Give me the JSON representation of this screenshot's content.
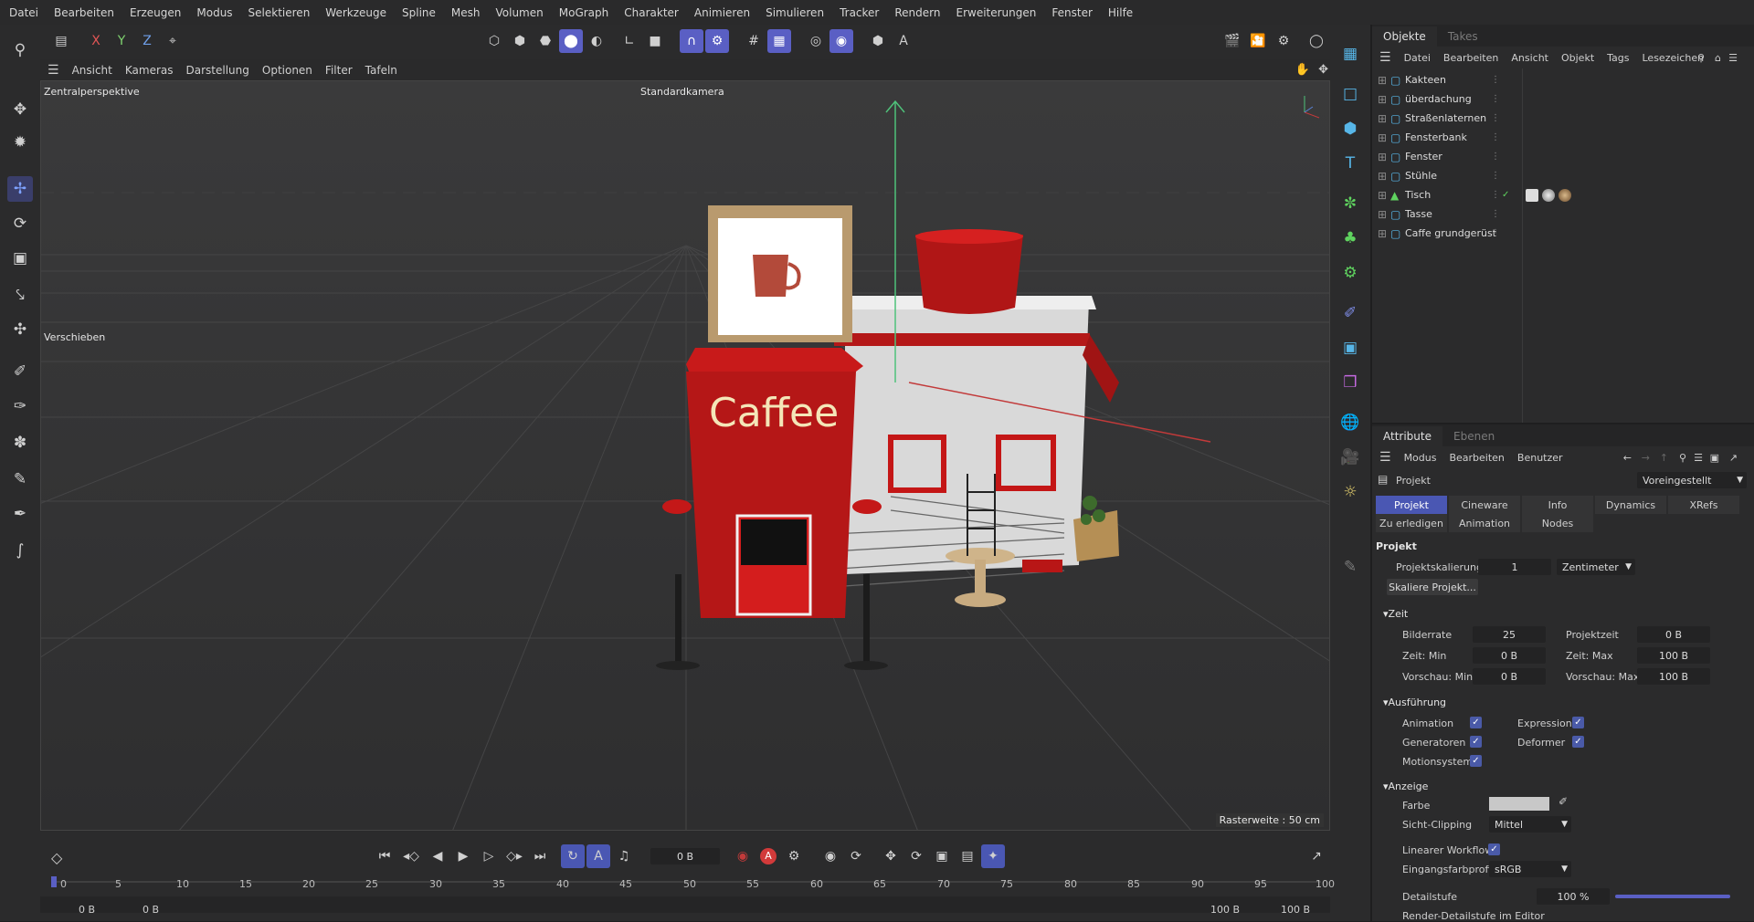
{
  "menubar": {
    "items": [
      "Datei",
      "Bearbeiten",
      "Erzeugen",
      "Modus",
      "Selektieren",
      "Werkzeuge",
      "Spline",
      "Mesh",
      "Volumen",
      "MoGraph",
      "Charakter",
      "Animieren",
      "Simulieren",
      "Tracker",
      "Rendern",
      "Erweiterungen",
      "Fenster",
      "Hilfe"
    ]
  },
  "toolbar": {
    "axis_x": "X",
    "axis_y": "Y",
    "axis_z": "Z"
  },
  "viewmenu": {
    "items": [
      "Ansicht",
      "Kameras",
      "Darstellung",
      "Optionen",
      "Filter",
      "Tafeln"
    ]
  },
  "viewport": {
    "perspective_label": "Zentralperspektive",
    "camera_label": "Standardkamera",
    "tool_label": "Verschieben",
    "grid_label": "Rasterweite : 50 cm",
    "sign_text": "Caffee"
  },
  "objects": {
    "tabs": [
      "Objekte",
      "Takes"
    ],
    "menu": [
      "Datei",
      "Bearbeiten",
      "Ansicht",
      "Objekt",
      "Tags",
      "Lesezeichen"
    ],
    "items": [
      {
        "name": "Kakteen"
      },
      {
        "name": "überdachung"
      },
      {
        "name": "Straßenlaternen"
      },
      {
        "name": "Fensterbank"
      },
      {
        "name": "Fenster"
      },
      {
        "name": "Stühle"
      },
      {
        "name": "Tisch"
      },
      {
        "name": "Tasse"
      },
      {
        "name": "Caffe grundgerüst"
      }
    ]
  },
  "attributes": {
    "tabs": [
      "Attribute",
      "Ebenen"
    ],
    "menu": [
      "Modus",
      "Bearbeiten",
      "Benutzer"
    ],
    "object_label": "Projekt",
    "preset": "Voreingestellt",
    "ptabs_row1": [
      "Projekt",
      "Cineware",
      "Info",
      "Dynamics",
      "XRefs"
    ],
    "ptabs_row2": [
      "Zu erledigen",
      "Animation",
      "Nodes"
    ],
    "section_projekt": "Projekt",
    "projektskalierung_label": "Projektskalierung",
    "projektskalierung_value": "1",
    "unit": "Zentimeter",
    "skalieren_button": "Skaliere Projekt...",
    "section_zeit": "Zeit",
    "bilderrate_label": "Bilderrate",
    "bilderrate": "25",
    "projektzeit_label": "Projektzeit",
    "projektzeit": "0 B",
    "zeitmin_label": "Zeit: Min",
    "zeitmin": "0 B",
    "zeitmax_label": "Zeit: Max",
    "zeitmax": "100 B",
    "vormin_label": "Vorschau: Min",
    "vormin": "0 B",
    "vormax_label": "Vorschau: Max",
    "vormax": "100 B",
    "section_ausfuehrung": "Ausführung",
    "animation_label": "Animation",
    "expressions_label": "Expressions",
    "generatoren_label": "Generatoren",
    "deformer_label": "Deformer",
    "motionsystem_label": "Motionsystem",
    "section_anzeige": "Anzeige",
    "farbe_label": "Farbe",
    "farbe_color": "#c8c8c8",
    "sicht_label": "Sicht-Clipping",
    "sicht_value": "Mittel",
    "linear_label": "Linearer Workflow",
    "eingang_label": "Eingangsfarbprofil",
    "eingang_value": "sRGB",
    "detail_label": "Detailstufe",
    "detail_value": "100 %",
    "render_detail_label": "Render-Detailstufe im Editor"
  },
  "timeline": {
    "current_frame": "0 B",
    "ticks": [
      "0",
      "5",
      "10",
      "15",
      "20",
      "25",
      "30",
      "35",
      "40",
      "45",
      "50",
      "55",
      "60",
      "65",
      "70",
      "75",
      "80",
      "85",
      "90",
      "95",
      "100"
    ],
    "range_start": "0 B",
    "range_inner_start": "0 B",
    "range_inner_end": "100 B",
    "range_end": "100 B"
  }
}
